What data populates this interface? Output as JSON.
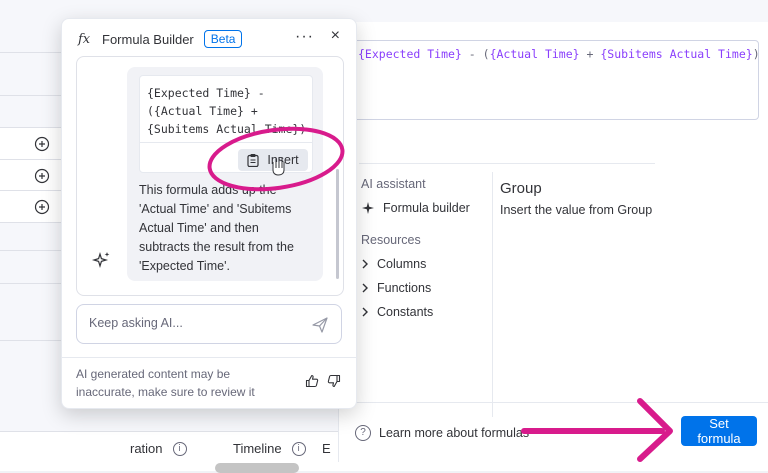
{
  "formula_builder": {
    "title": "Formula Builder",
    "badge": "Beta",
    "more_label": "···",
    "close_label": "×",
    "code_lines": [
      "{Expected Time} -",
      "({Actual Time} +",
      "{Subitems Actual Time})"
    ],
    "insert_label": "Insert",
    "message": "This formula adds up the 'Actual Time' and 'Subitems Actual Time' and then subtracts the result from the 'Expected Time'.",
    "ask_placeholder": "Keep asking AI...",
    "disclaimer": "AI generated content may be inaccurate, make sure to review it"
  },
  "editor": {
    "formula_tokens": [
      {
        "text": "{Expected Time}",
        "kind": "column"
      },
      {
        "text": " - (",
        "kind": "op"
      },
      {
        "text": "{Actual Time}",
        "kind": "column"
      },
      {
        "text": " + ",
        "kind": "op"
      },
      {
        "text": "{Subitems Actual Time}",
        "kind": "column"
      },
      {
        "text": ")",
        "kind": "op"
      }
    ],
    "ai_heading": "AI assistant",
    "formula_builder_item": "Formula builder",
    "resources_heading": "Resources",
    "resources": [
      "Columns",
      "Functions",
      "Constants"
    ],
    "detail_title": "Group",
    "detail_desc": "Insert the value from Group",
    "learn_more": "Learn more about formulas",
    "set_formula": "Set formula"
  },
  "board": {
    "col_duration": "ration",
    "col_timeline": "Timeline",
    "col_next": "E"
  },
  "colors": {
    "primary": "#0073ea",
    "annotation": "#d81b8c",
    "column_token": "#8a3ffc"
  }
}
